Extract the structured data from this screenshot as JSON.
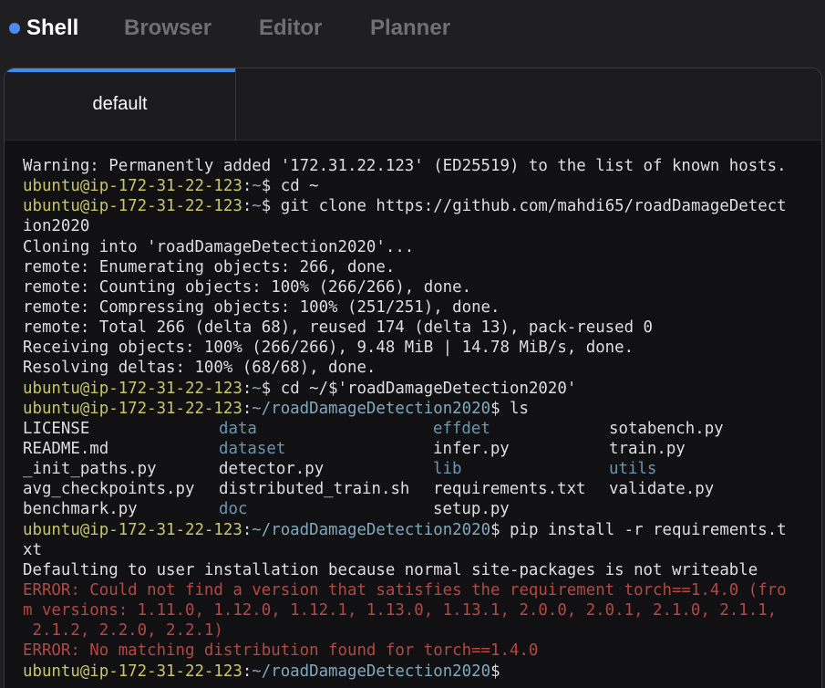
{
  "nav": {
    "tabs": [
      {
        "label": "Shell",
        "active": true
      },
      {
        "label": "Browser",
        "active": false
      },
      {
        "label": "Editor",
        "active": false
      },
      {
        "label": "Planner",
        "active": false
      }
    ]
  },
  "terminal": {
    "tab_label": "default",
    "prompt_user": "ubuntu@ip-172-31-22-123",
    "lines": {
      "warning": "Warning: Permanently added '172.31.22.123' (ED25519) to the list of known hosts.",
      "cmd1_path": "~",
      "cmd1": " cd ~",
      "cmd2_path": "~",
      "cmd2": " git clone https://github.com/mahdi65/roadDamageDetect",
      "cmd2_wrap": "ion2020",
      "clone1": "Cloning into 'roadDamageDetection2020'...",
      "clone2": "remote: Enumerating objects: 266, done.",
      "clone3": "remote: Counting objects: 100% (266/266), done.",
      "clone4": "remote: Compressing objects: 100% (251/251), done.",
      "clone5": "remote: Total 266 (delta 68), reused 174 (delta 13), pack-reused 0",
      "clone6": "Receiving objects: 100% (266/266), 9.48 MiB | 14.78 MiB/s, done.",
      "clone7": "Resolving deltas: 100% (68/68), done.",
      "cmd3_path": "~",
      "cmd3": " cd ~/$'roadDamageDetection2020'",
      "cmd4_path": "~/roadDamageDetection2020",
      "cmd4": " ls",
      "cmd5_path": "~/roadDamageDetection2020",
      "cmd5": " pip install -r requirements.t",
      "cmd5_wrap": "xt",
      "pip1": "Defaulting to user installation because normal site-packages is not writeable",
      "err1a": "ERROR: Could not find a version that satisfies the requirement torch==1.4.0 (fro",
      "err1b": "m versions: 1.11.0, 1.12.0, 1.12.1, 1.13.0, 1.13.1, 2.0.0, 2.0.1, 2.1.0, 2.1.1,",
      "err1c": " 2.1.2, 2.2.0, 2.2.1)",
      "err2": "ERROR: No matching distribution found for torch==1.4.0",
      "final_path": "~/roadDamageDetection2020"
    },
    "ls_rows": [
      [
        {
          "name": "LICENSE",
          "dir": false
        },
        {
          "name": "data",
          "dir": true
        },
        {
          "name": "effdet",
          "dir": true
        },
        {
          "name": "sotabench.py",
          "dir": false
        }
      ],
      [
        {
          "name": "README.md",
          "dir": false
        },
        {
          "name": "dataset",
          "dir": true
        },
        {
          "name": "infer.py",
          "dir": false
        },
        {
          "name": "train.py",
          "dir": false
        }
      ],
      [
        {
          "name": "_init_paths.py",
          "dir": false
        },
        {
          "name": "detector.py",
          "dir": false
        },
        {
          "name": "lib",
          "dir": true
        },
        {
          "name": "utils",
          "dir": true
        }
      ],
      [
        {
          "name": "avg_checkpoints.py",
          "dir": false
        },
        {
          "name": "distributed_train.sh",
          "dir": false
        },
        {
          "name": "requirements.txt",
          "dir": false
        },
        {
          "name": "validate.py",
          "dir": false
        }
      ],
      [
        {
          "name": "benchmark.py",
          "dir": false
        },
        {
          "name": "doc",
          "dir": true
        },
        {
          "name": "setup.py",
          "dir": false
        },
        {
          "name": "",
          "dir": false
        }
      ]
    ]
  },
  "colors": {
    "accent": "#3d8fef",
    "prompt_user": "#c9c66a",
    "prompt_path": "#7fa9bf",
    "directory": "#6b97b3",
    "error": "#b44843"
  }
}
